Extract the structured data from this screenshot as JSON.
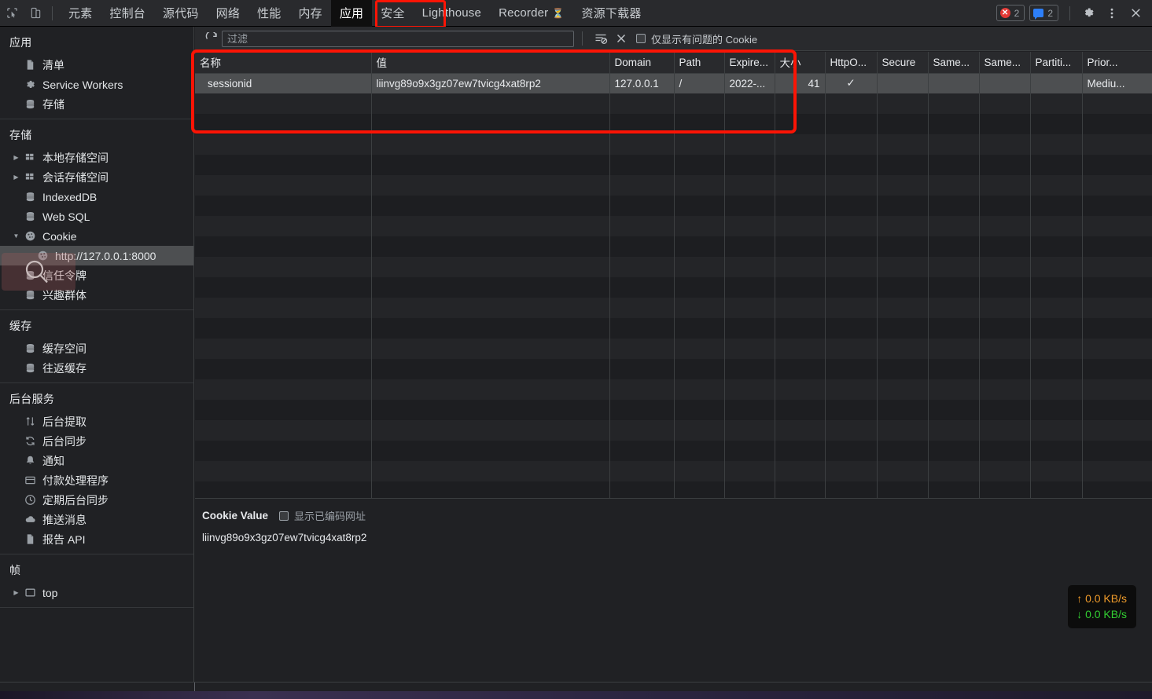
{
  "tabbar": {
    "tabs": [
      {
        "label": "元素",
        "selected": false,
        "latin": false
      },
      {
        "label": "控制台",
        "selected": false,
        "latin": false
      },
      {
        "label": "源代码",
        "selected": false,
        "latin": false
      },
      {
        "label": "网络",
        "selected": false,
        "latin": false
      },
      {
        "label": "性能",
        "selected": false,
        "latin": false
      },
      {
        "label": "内存",
        "selected": false,
        "latin": false
      },
      {
        "label": "应用",
        "selected": true,
        "latin": false
      },
      {
        "label": "安全",
        "selected": false,
        "latin": false
      },
      {
        "label": "Lighthouse",
        "selected": false,
        "latin": true
      },
      {
        "label": "Recorder",
        "selected": false,
        "latin": true,
        "glyph": "⏳"
      },
      {
        "label": "资源下载器",
        "selected": false,
        "latin": false
      }
    ],
    "error_badge_count": "2",
    "message_badge_count": "2",
    "icons": {
      "inspect": "inspect-element-icon",
      "device": "device-toolbar-icon",
      "settings": "gear-icon",
      "more": "more-vertical-icon",
      "close": "close-icon"
    }
  },
  "sidebar": {
    "sections": [
      {
        "title": "应用",
        "items": [
          {
            "label": "清单",
            "icon": "document-icon",
            "arrow": "none",
            "indent": 1,
            "selected": false
          },
          {
            "label": "Service Workers",
            "icon": "gear-icon",
            "arrow": "none",
            "indent": 1,
            "selected": false
          },
          {
            "label": "存储",
            "icon": "database-icon",
            "arrow": "none",
            "indent": 1,
            "selected": false
          }
        ]
      },
      {
        "title": "存储",
        "items": [
          {
            "label": "本地存储空间",
            "icon": "grid-icon",
            "arrow": "collapsed",
            "indent": 1,
            "selected": false
          },
          {
            "label": "会话存储空间",
            "icon": "grid-icon",
            "arrow": "collapsed",
            "indent": 1,
            "selected": false
          },
          {
            "label": "IndexedDB",
            "icon": "database-icon",
            "arrow": "none",
            "indent": 1,
            "selected": false
          },
          {
            "label": "Web SQL",
            "icon": "database-icon",
            "arrow": "none",
            "indent": 1,
            "selected": false
          },
          {
            "label": "Cookie",
            "icon": "cookie-icon",
            "arrow": "expanded",
            "indent": 1,
            "selected": false
          },
          {
            "label": "http://127.0.0.1:8000",
            "icon": "cookie-icon",
            "arrow": "none",
            "indent": 2,
            "selected": true
          },
          {
            "label": "信任令牌",
            "icon": "database-icon",
            "arrow": "none",
            "indent": 1,
            "selected": false
          },
          {
            "label": "兴趣群体",
            "icon": "database-icon",
            "arrow": "none",
            "indent": 1,
            "selected": false
          }
        ]
      },
      {
        "title": "缓存",
        "items": [
          {
            "label": "缓存空间",
            "icon": "database-icon",
            "arrow": "none",
            "indent": 1,
            "selected": false
          },
          {
            "label": "往返缓存",
            "icon": "database-icon",
            "arrow": "none",
            "indent": 1,
            "selected": false
          }
        ]
      },
      {
        "title": "后台服务",
        "items": [
          {
            "label": "后台提取",
            "icon": "arrows-updown-icon",
            "arrow": "none",
            "indent": 1,
            "selected": false
          },
          {
            "label": "后台同步",
            "icon": "sync-icon",
            "arrow": "none",
            "indent": 1,
            "selected": false
          },
          {
            "label": "通知",
            "icon": "bell-icon",
            "arrow": "none",
            "indent": 1,
            "selected": false
          },
          {
            "label": "付款处理程序",
            "icon": "card-icon",
            "arrow": "none",
            "indent": 1,
            "selected": false
          },
          {
            "label": "定期后台同步",
            "icon": "clock-icon",
            "arrow": "none",
            "indent": 1,
            "selected": false
          },
          {
            "label": "推送消息",
            "icon": "cloud-icon",
            "arrow": "none",
            "indent": 1,
            "selected": false
          },
          {
            "label": "报告 API",
            "icon": "document-icon",
            "arrow": "none",
            "indent": 1,
            "selected": false
          }
        ]
      },
      {
        "title": "帧",
        "items": [
          {
            "label": "top",
            "icon": "frame-icon",
            "arrow": "collapsed",
            "indent": 1,
            "selected": false
          }
        ]
      }
    ]
  },
  "toolbar": {
    "refresh_icon": "refresh-icon",
    "filter_placeholder": "过滤",
    "filter_value": "",
    "clear_filtered_icon": "clear-filtered-cookies-icon",
    "clear_all_icon": "clear-all-icon",
    "only_problem_checkbox_label": "仅显示有问题的 Cookie",
    "only_problem_checked": false
  },
  "table": {
    "columns": [
      "名称",
      "值",
      "Domain",
      "Path",
      "Expire...",
      "大小",
      "HttpO...",
      "Secure",
      "Same...",
      "Same...",
      "Partiti...",
      "Prior..."
    ],
    "rows": [
      {
        "name": "sessionid",
        "value": "liinvg89o9x3gz07ew7tvicg4xat8rp2",
        "domain": "127.0.0.1",
        "path": "/",
        "expires": "2022-...",
        "size": "41",
        "httponly": "✓",
        "secure": "",
        "samesite": "",
        "samesite2": "",
        "partition": "",
        "priority": "Mediu..."
      }
    ]
  },
  "detail": {
    "title": "Cookie Value",
    "show_encoded_label": "显示已编码网址",
    "show_encoded_checked": false,
    "value": "liinvg89o9x3gz07ew7tvicg4xat8rp2"
  },
  "netspeed": {
    "upload": "0.0 KB/s",
    "download": "0.0 KB/s",
    "up_arrow": "↑",
    "down_arrow": "↓"
  },
  "annotations": {
    "color": "#fb1405",
    "tab_box": "应用",
    "table_box": "cookie-table-region"
  }
}
